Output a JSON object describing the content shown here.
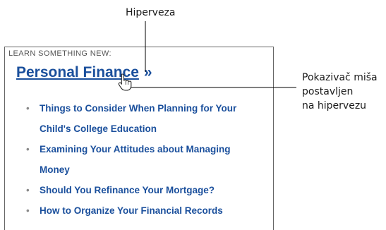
{
  "callouts": {
    "hyperlink": "Hiperveza",
    "pointer_lines": [
      "Pokazivač miša",
      "postavljen",
      "na hipervezu"
    ]
  },
  "panel": {
    "header": "LEARN SOMETHING NEW:",
    "title": "Personal Finance",
    "title_suffix": "»",
    "articles": [
      {
        "line1": "Things to Consider When Planning for Your",
        "line2": "Child's College Education"
      },
      {
        "line1": "Examining Your Attitudes about Managing",
        "line2": "Money"
      },
      {
        "line1": "Should You Refinance Your Mortgage?"
      },
      {
        "line1": "How to Organize Your Financial Records"
      }
    ]
  },
  "colors": {
    "link": "#1a4f9c",
    "bullet": "#8a8a8a",
    "border": "#666666",
    "leader": "#000000"
  },
  "icons": [
    "hand-pointer-icon"
  ]
}
